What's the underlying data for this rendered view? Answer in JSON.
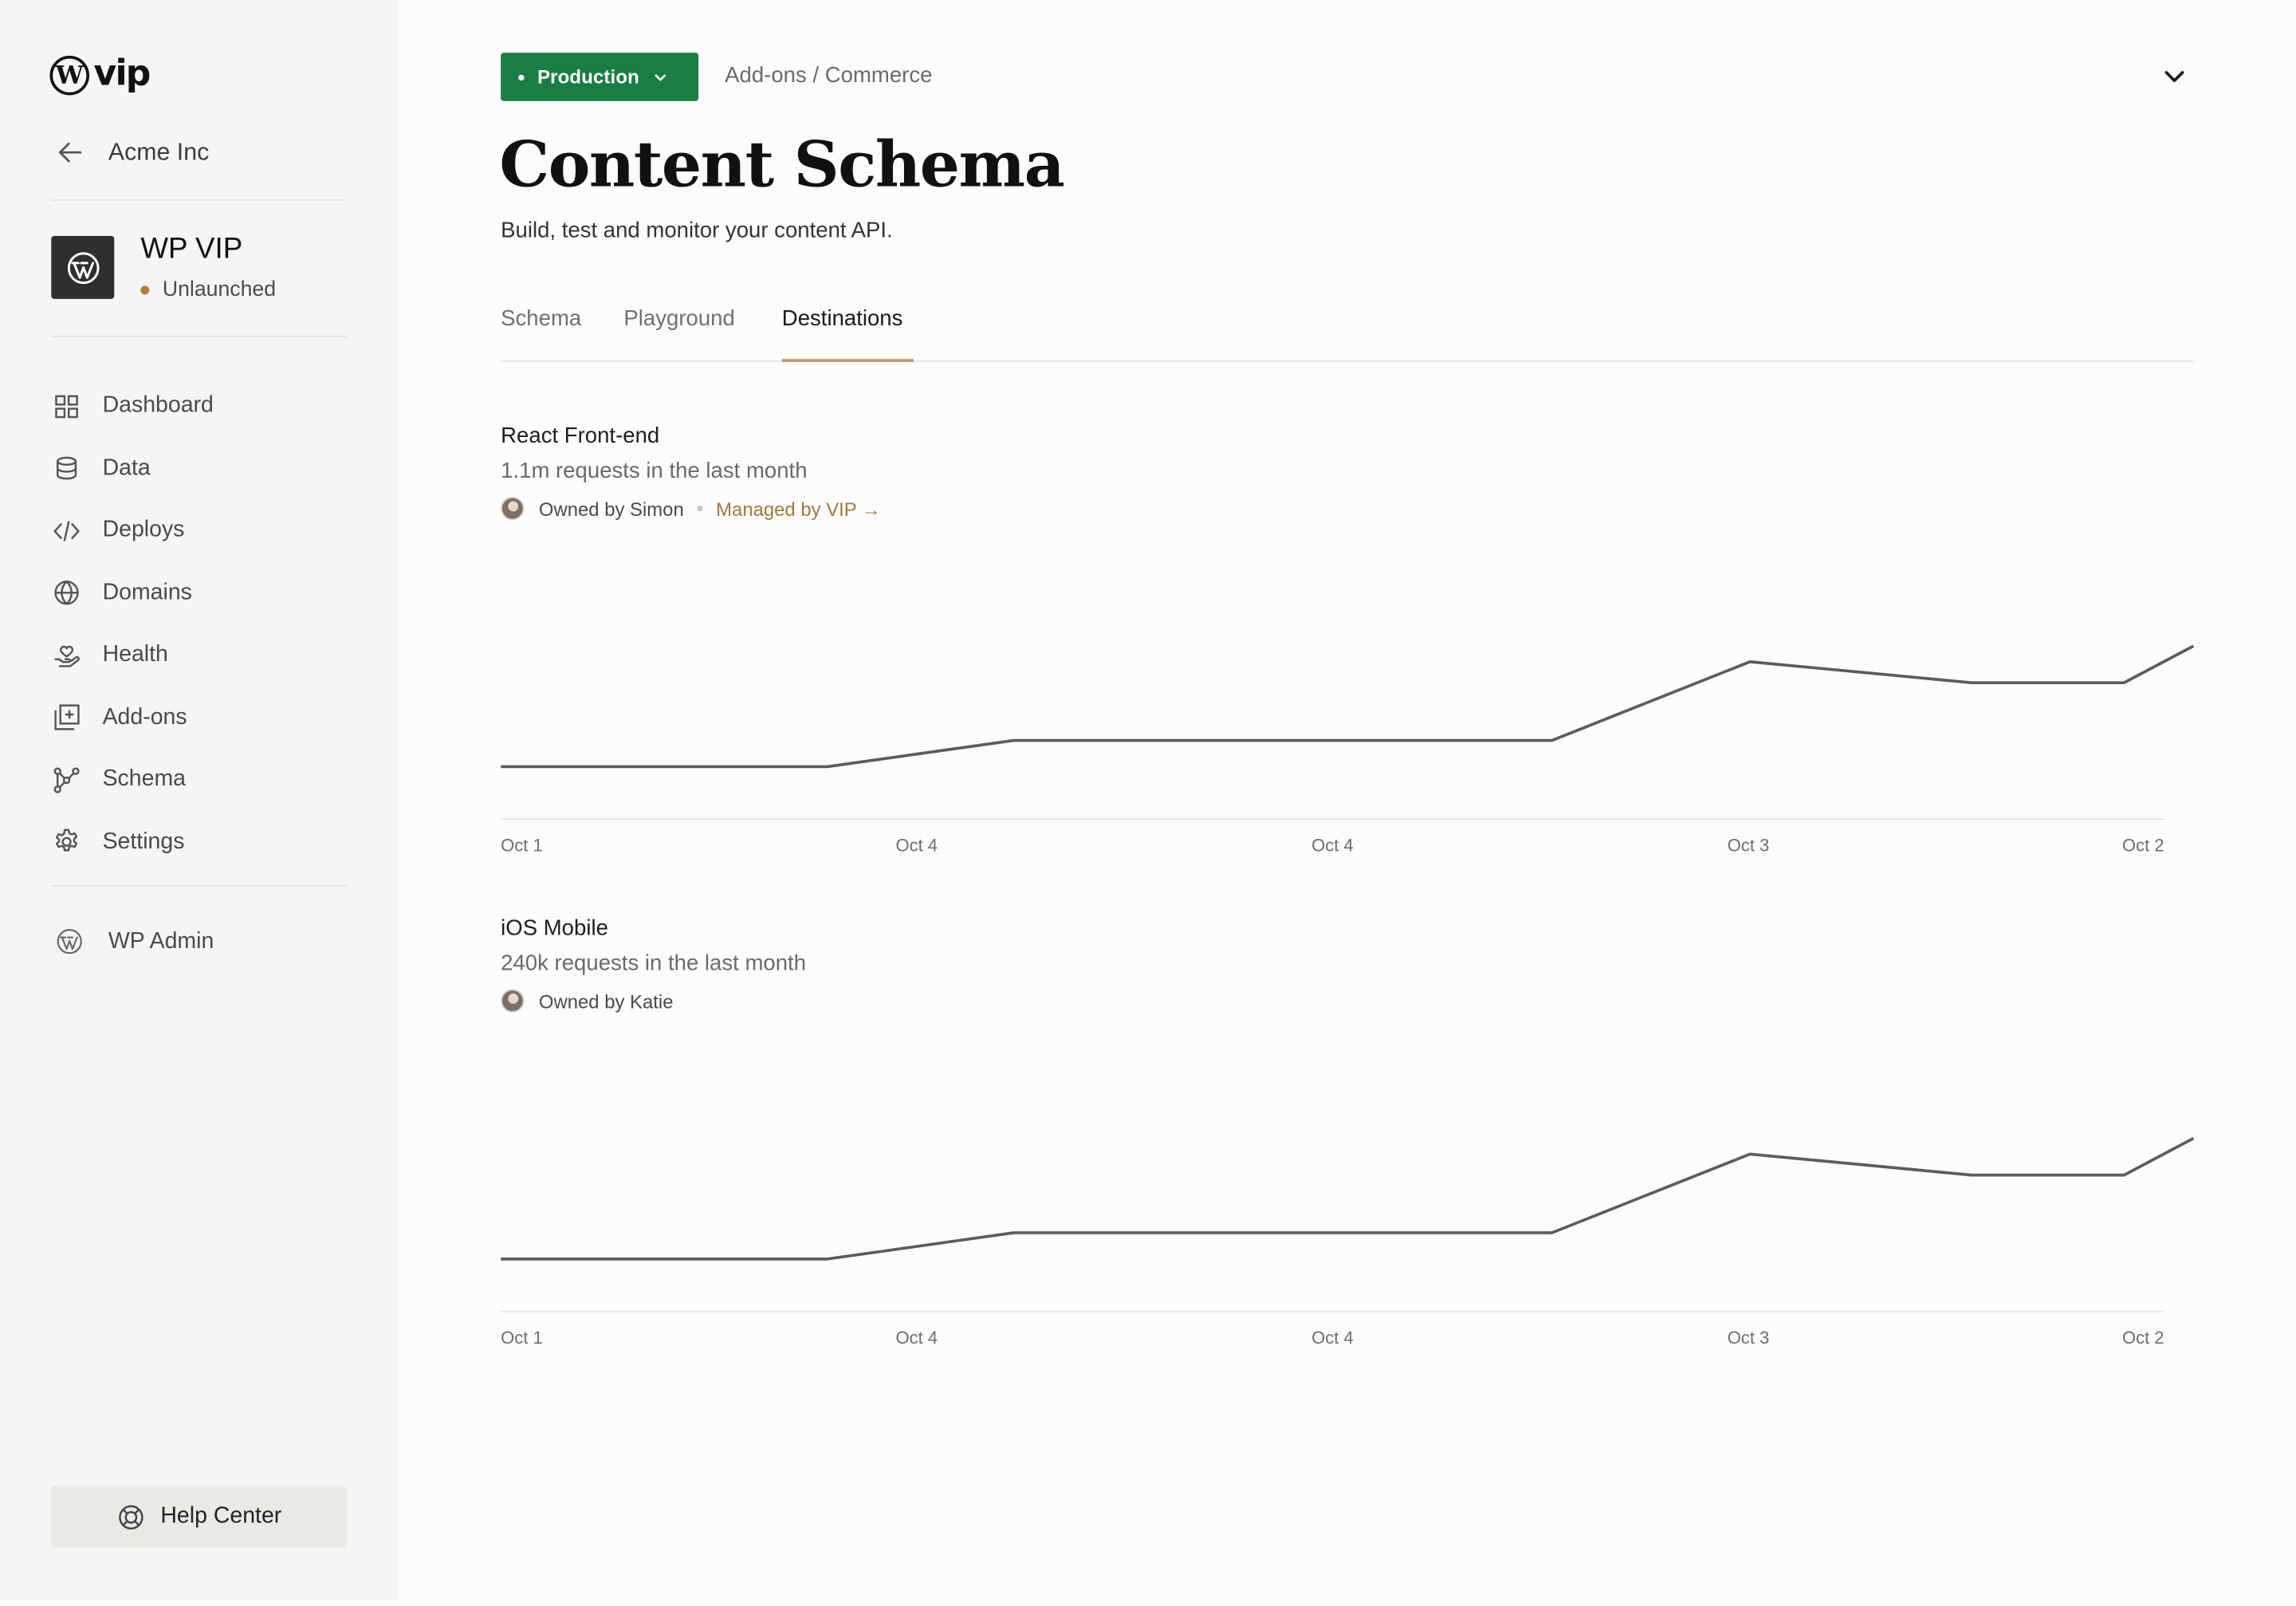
{
  "brand": {
    "logo_mark": "W",
    "logo_text": "vip"
  },
  "sidebar": {
    "back_label": "Acme Inc",
    "site": {
      "name": "WP VIP",
      "status": "Unlaunched",
      "status_color": "#b07d3a"
    },
    "nav": [
      {
        "label": "Dashboard",
        "icon": "dashboard-icon"
      },
      {
        "label": "Data",
        "icon": "database-icon"
      },
      {
        "label": "Deploys",
        "icon": "code-icon"
      },
      {
        "label": "Domains",
        "icon": "globe-icon"
      },
      {
        "label": "Health",
        "icon": "health-icon"
      },
      {
        "label": "Add-ons",
        "icon": "add-ons-icon"
      },
      {
        "label": "Schema",
        "icon": "schema-icon"
      },
      {
        "label": "Settings",
        "icon": "gear-icon"
      }
    ],
    "wp_admin": "WP Admin",
    "help_center": "Help Center"
  },
  "header": {
    "environment": "Production",
    "environment_color": "#1a7e44",
    "breadcrumb": "Add-ons / Commerce",
    "title": "Content Schema",
    "subtitle": "Build, test and monitor your content API."
  },
  "tabs": [
    {
      "label": "Schema",
      "active": false
    },
    {
      "label": "Playground",
      "active": false
    },
    {
      "label": "Destinations",
      "active": true
    }
  ],
  "destinations": [
    {
      "title": "React Front-end",
      "requests": "1.1m requests in the last month",
      "owner": "Owned by Simon",
      "managed": "Managed by VIP →"
    },
    {
      "title": "iOS Mobile",
      "requests": "240k requests in the last month",
      "owner": "Owned by Katie"
    }
  ],
  "chart_data": [
    {
      "type": "line",
      "x_ticks": [
        "Oct 1",
        "Oct 4",
        "Oct 4",
        "Oct 3",
        "Oct 2"
      ],
      "series": [
        {
          "values": [
            10,
            10,
            15,
            15,
            15,
            30,
            26,
            26,
            33
          ]
        }
      ],
      "x": [
        0,
        0.193,
        0.303,
        0.523,
        0.621,
        0.738,
        0.869,
        0.959,
        1.0
      ],
      "ylim": [
        0,
        50
      ],
      "grid": false
    },
    {
      "type": "line",
      "x_ticks": [
        "Oct 1",
        "Oct 4",
        "Oct 4",
        "Oct 3",
        "Oct 2"
      ],
      "series": [
        {
          "values": [
            10,
            10,
            15,
            15,
            15,
            30,
            26,
            26,
            33
          ]
        }
      ],
      "x": [
        0,
        0.193,
        0.303,
        0.523,
        0.621,
        0.738,
        0.869,
        0.959,
        1.0
      ],
      "ylim": [
        0,
        50
      ],
      "grid": false
    }
  ]
}
